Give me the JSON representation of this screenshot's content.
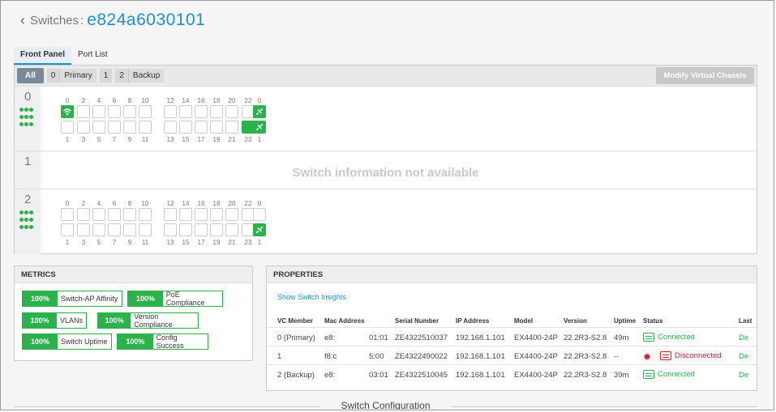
{
  "header": {
    "back_glyph": "‹",
    "breadcrumb_parent": "Switches",
    "separator": ":",
    "title": "e824a6030101"
  },
  "tabs": [
    {
      "label": "Front Panel",
      "active": true
    },
    {
      "label": "Port List",
      "active": false
    }
  ],
  "toolbar": {
    "all_label": "All",
    "filters": [
      {
        "num": "0",
        "label": "Primary"
      },
      {
        "num": "1",
        "label": ""
      },
      {
        "num": "2",
        "label": "Backup"
      }
    ],
    "modify_label": "Modify Virtual Chassis"
  },
  "members": [
    {
      "id": "0",
      "available": true
    },
    {
      "id": "1",
      "available": false,
      "message": "Switch information not available"
    },
    {
      "id": "2",
      "available": true
    }
  ],
  "ports": {
    "top_numbers": [
      "0",
      "2",
      "4",
      "6",
      "8",
      "10",
      "12",
      "14",
      "16",
      "18",
      "20",
      "22"
    ],
    "bottom_numbers": [
      "1",
      "3",
      "5",
      "7",
      "9",
      "11",
      "13",
      "15",
      "17",
      "19",
      "21",
      "23"
    ],
    "uplink_top": "0",
    "uplink_bottom": "1"
  },
  "metrics": {
    "title": "METRICS",
    "items": [
      {
        "pct": "100%",
        "label": "Switch-AP Affinity"
      },
      {
        "pct": "100%",
        "label": "PoE Compliance"
      },
      {
        "pct": "100%",
        "label": "VLANs"
      },
      {
        "pct": "100%",
        "label": "Version Compliance"
      },
      {
        "pct": "100%",
        "label": "Switch Uptime"
      },
      {
        "pct": "100%",
        "label": "Config Success"
      }
    ]
  },
  "properties": {
    "title": "PROPERTIES",
    "insights_link": "Show Switch Insights",
    "columns": [
      "VC Member",
      "Mac Address",
      "Serial Number",
      "IP Address",
      "Model",
      "Version",
      "Uptime",
      "Status",
      "Last"
    ],
    "rows": [
      {
        "member": "0 (Primary)",
        "mac_a": "e8:",
        "mac_b": "01:01",
        "serial": "ZE4322510037",
        "ip": "192.168.1.101",
        "model": "EX4400-24P",
        "version": "22.2R3-S2.8",
        "uptime": "49m",
        "status": "Connected",
        "last": "De"
      },
      {
        "member": "1",
        "mac_a": "f8:c",
        "mac_b": "5:00",
        "serial": "ZE4322490022",
        "ip": "192.168.1.101",
        "model": "EX4400-24P",
        "version": "22.2R3-S2.8",
        "uptime": "--",
        "status": "Disconnected",
        "last": "De"
      },
      {
        "member": "2 (Backup)",
        "mac_a": "e8:",
        "mac_b": "03:01",
        "serial": "ZE4322510045",
        "ip": "192.168.1.101",
        "model": "EX4400-24P",
        "version": "22.2R3-S2.8",
        "uptime": "39m",
        "status": "Connected",
        "last": "De"
      }
    ]
  },
  "footer": {
    "section_title": "Switch Configuration"
  },
  "colors": {
    "accent": "#1d8fd6",
    "ok": "#2bb24c",
    "error": "#d0202f"
  }
}
